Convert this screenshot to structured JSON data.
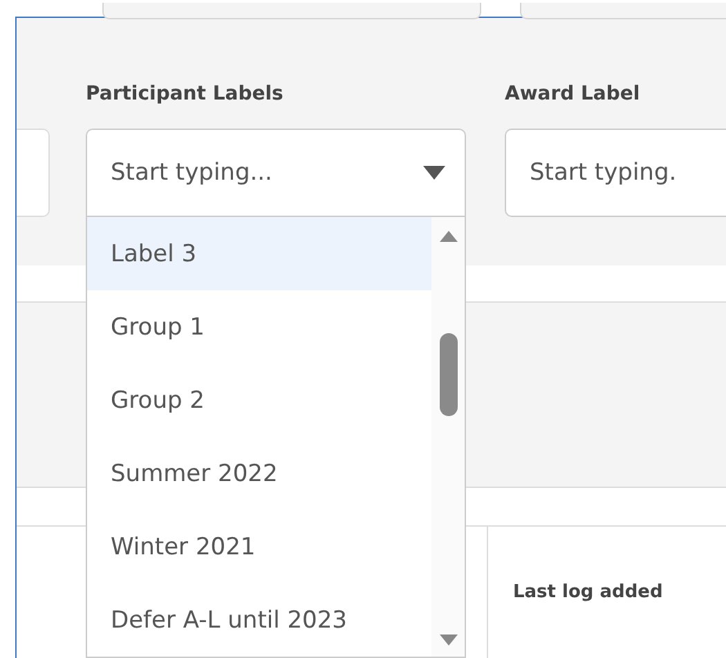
{
  "participant_labels": {
    "label": "Participant Labels",
    "placeholder": "Start typing...",
    "expanded": true,
    "options": [
      {
        "label": "Label 3",
        "selected": true
      },
      {
        "label": "Group 1",
        "selected": false
      },
      {
        "label": "Group 2",
        "selected": false
      },
      {
        "label": "Summer 2022",
        "selected": false
      },
      {
        "label": "Winter 2021",
        "selected": false
      },
      {
        "label": "Defer A-L until 2023",
        "selected": false
      }
    ]
  },
  "award_label": {
    "label": "Award Label",
    "placeholder": "Start typing."
  },
  "table": {
    "columns": [
      "Last log added"
    ]
  }
}
